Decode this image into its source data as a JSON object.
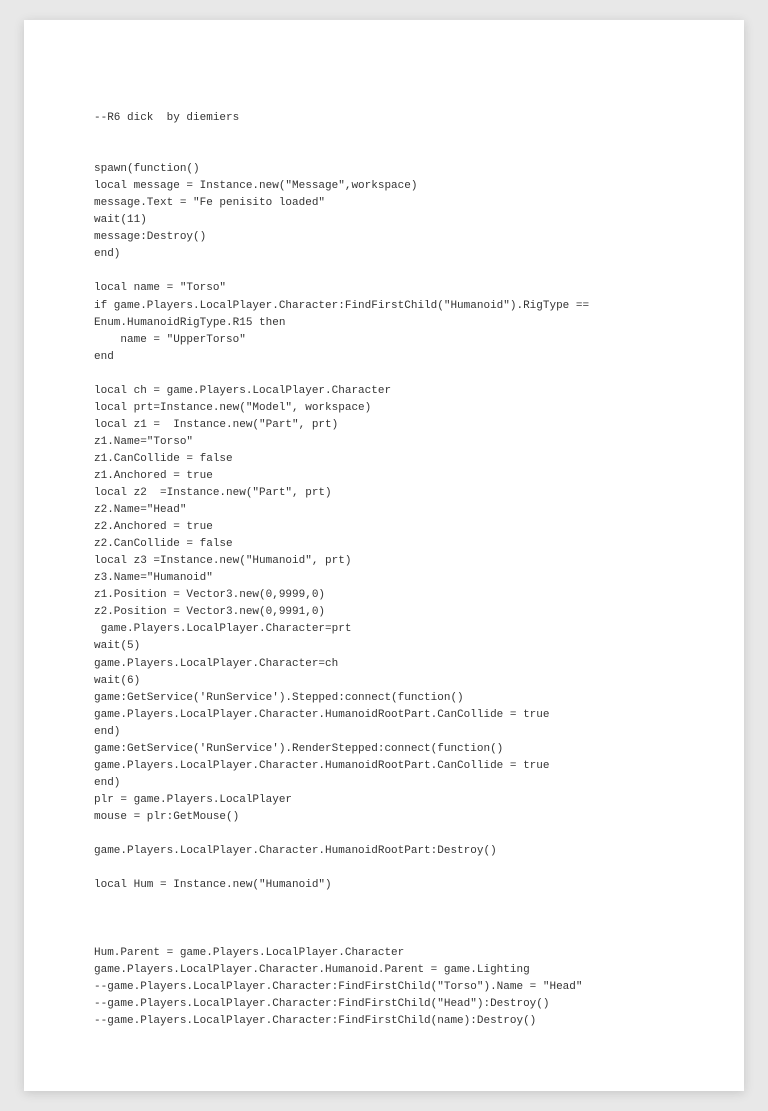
{
  "code": {
    "lines": [
      "--R6 dick  by diemiers",
      "",
      "",
      "spawn(function()",
      "local message = Instance.new(\"Message\",workspace)",
      "message.Text = \"Fe penisito loaded\"",
      "wait(11)",
      "message:Destroy()",
      "end)",
      "",
      "local name = \"Torso\"",
      "if game.Players.LocalPlayer.Character:FindFirstChild(\"Humanoid\").RigType ==",
      "Enum.HumanoidRigType.R15 then",
      "    name = \"UpperTorso\"",
      "end",
      "",
      "local ch = game.Players.LocalPlayer.Character",
      "local prt=Instance.new(\"Model\", workspace)",
      "local z1 =  Instance.new(\"Part\", prt)",
      "z1.Name=\"Torso\"",
      "z1.CanCollide = false",
      "z1.Anchored = true",
      "local z2  =Instance.new(\"Part\", prt)",
      "z2.Name=\"Head\"",
      "z2.Anchored = true",
      "z2.CanCollide = false",
      "local z3 =Instance.new(\"Humanoid\", prt)",
      "z3.Name=\"Humanoid\"",
      "z1.Position = Vector3.new(0,9999,0)",
      "z2.Position = Vector3.new(0,9991,0)",
      " game.Players.LocalPlayer.Character=prt",
      "wait(5)",
      "game.Players.LocalPlayer.Character=ch",
      "wait(6)",
      "game:GetService('RunService').Stepped:connect(function()",
      "game.Players.LocalPlayer.Character.HumanoidRootPart.CanCollide = true",
      "end)",
      "game:GetService('RunService').RenderStepped:connect(function()",
      "game.Players.LocalPlayer.Character.HumanoidRootPart.CanCollide = true",
      "end)",
      "plr = game.Players.LocalPlayer",
      "mouse = plr:GetMouse()",
      "",
      "game.Players.LocalPlayer.Character.HumanoidRootPart:Destroy()",
      "",
      "local Hum = Instance.new(\"Humanoid\")",
      "   ",
      "",
      "",
      "Hum.Parent = game.Players.LocalPlayer.Character",
      "game.Players.LocalPlayer.Character.Humanoid.Parent = game.Lighting",
      "--game.Players.LocalPlayer.Character:FindFirstChild(\"Torso\").Name = \"Head\"",
      "--game.Players.LocalPlayer.Character:FindFirstChild(\"Head\"):Destroy()",
      "--game.Players.LocalPlayer.Character:FindFirstChild(name):Destroy()"
    ]
  }
}
